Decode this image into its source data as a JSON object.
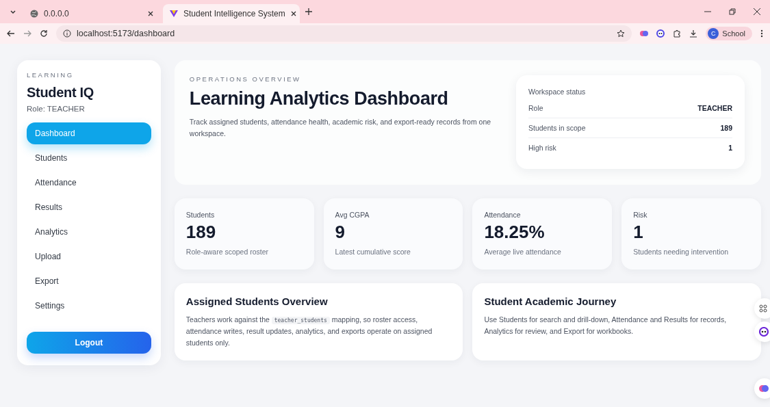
{
  "browser": {
    "tabs": [
      {
        "title": "0.0.0.0",
        "selected": false
      },
      {
        "title": "Student Intelligence System",
        "selected": true
      }
    ],
    "address": "localhost:5173/dashboard",
    "profile": {
      "initial": "C",
      "name": "School"
    }
  },
  "sidebar": {
    "eyebrow": "LEARNING",
    "title": "Student IQ",
    "role": "Role: TEACHER",
    "items": [
      {
        "label": "Dashboard",
        "selected": true
      },
      {
        "label": "Students",
        "selected": false
      },
      {
        "label": "Attendance",
        "selected": false
      },
      {
        "label": "Results",
        "selected": false
      },
      {
        "label": "Analytics",
        "selected": false
      },
      {
        "label": "Upload",
        "selected": false
      },
      {
        "label": "Export",
        "selected": false
      },
      {
        "label": "Settings",
        "selected": false
      }
    ],
    "logout": "Logout"
  },
  "hero": {
    "eyebrow": "OPERATIONS OVERVIEW",
    "title": "Learning Analytics Dashboard",
    "description": "Track assigned students, attendance health, academic risk, and export-ready records from one workspace.",
    "status": {
      "title": "Workspace status",
      "rows": [
        {
          "label": "Role",
          "value": "TEACHER"
        },
        {
          "label": "Students in scope",
          "value": "189"
        },
        {
          "label": "High risk",
          "value": "1"
        }
      ]
    }
  },
  "stats": [
    {
      "label": "Students",
      "value": "189",
      "caption": "Role-aware scoped roster"
    },
    {
      "label": "Avg CGPA",
      "value": "9",
      "caption": "Latest cumulative score"
    },
    {
      "label": "Attendance",
      "value": "18.25%",
      "caption": "Average live attendance"
    },
    {
      "label": "Risk",
      "value": "1",
      "caption": "Students needing intervention"
    }
  ],
  "cards": [
    {
      "title": "Assigned Students Overview",
      "parts": [
        {
          "kind": "text",
          "text": "Teachers work against the "
        },
        {
          "kind": "code",
          "text": "teacher_students"
        },
        {
          "kind": "text",
          "text": " mapping, so roster access, attendance writes, result updates, analytics, and exports operate on assigned students only."
        }
      ]
    },
    {
      "title": "Student Academic Journey",
      "parts": [
        {
          "kind": "text",
          "text": "Use Students for search and drill-down, Attendance and Results for records, Analytics for review, and Export for workbooks."
        }
      ]
    }
  ]
}
